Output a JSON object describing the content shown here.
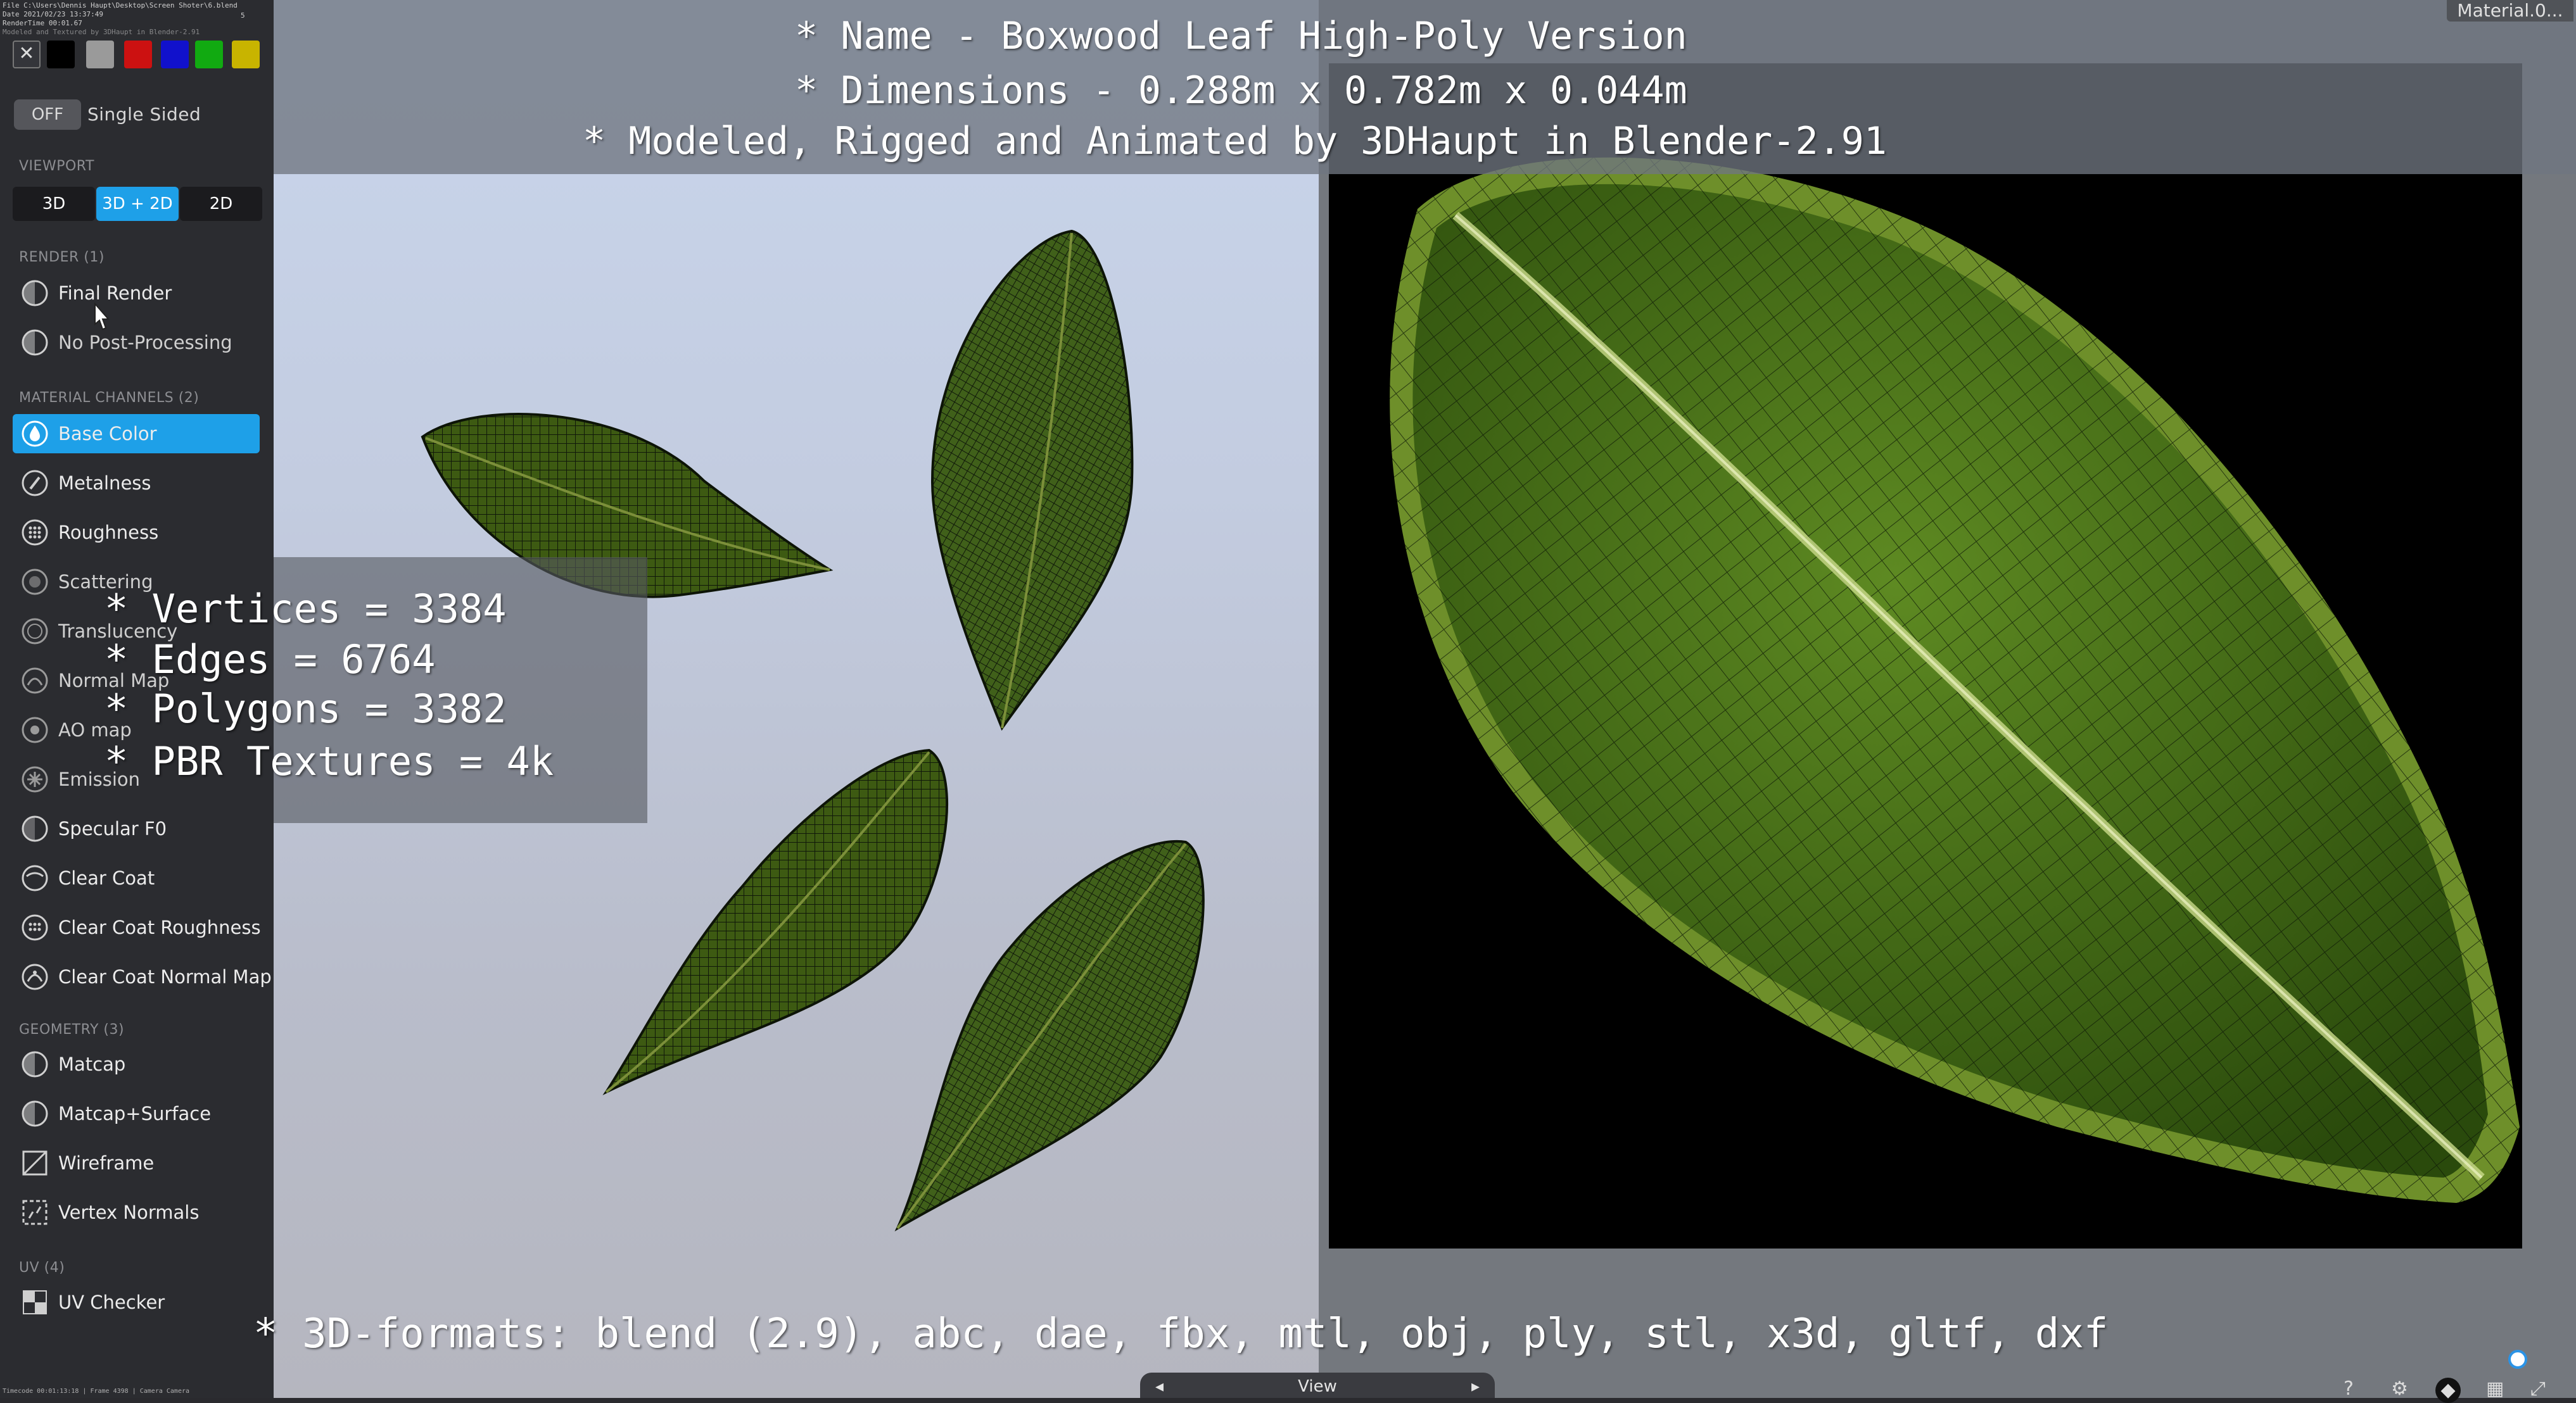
{
  "app": {
    "meta_lines": [
      "File C:\\Users\\Dennis Haupt\\Desktop\\Screen Shoter\\6.blend",
      "Date 2021/02/23 13:37:49",
      "RenderTime 00:01.67",
      "Modeled and Textured by 3DHaupt in Blender-2.91"
    ],
    "meta_corner": "5",
    "bottom_meta": "Timecode 00:01:13:18 | Frame 4398 | Camera Camera"
  },
  "sidebar": {
    "swatch_colors": [
      "#2b2c30",
      "#000000",
      "#9a9a9a",
      "#cc1111",
      "#1111cc",
      "#11aa11",
      "#c8b400"
    ],
    "single_sided_toggle": "OFF",
    "single_sided_label": "Single Sided",
    "viewport_header": "VIEWPORT",
    "viewport_buttons": [
      "3D",
      "3D + 2D",
      "2D"
    ],
    "render_header": "RENDER (1)",
    "render_items": [
      "Final Render",
      "No Post-Processing"
    ],
    "material_header": "MATERIAL CHANNELS (2)",
    "material_items": [
      "Base Color",
      "Metalness",
      "Roughness",
      "Scattering",
      "Translucency",
      "Normal Map",
      "AO map",
      "Emission",
      "Specular F0",
      "Clear Coat",
      "Clear Coat Roughness",
      "Clear Coat Normal Map"
    ],
    "geometry_header": "GEOMETRY (3)",
    "geometry_items": [
      "Matcap",
      "Matcap+Surface",
      "Wireframe",
      "Vertex Normals"
    ],
    "uv_header": "UV (4)",
    "uv_items": [
      "UV Checker"
    ]
  },
  "overlay": {
    "name_line": "* Name - Boxwood Leaf High-Poly Version",
    "dimensions_line": "* Dimensions -  0.288m x 0.782m x 0.044m",
    "credit_line": "* Modeled, Rigged and Animated by 3DHaupt in Blender-2.91",
    "stats": [
      "* Vertices = 3384",
      "* Edges = 6764",
      "* Polygons = 3382",
      "* PBR Textures = 4k"
    ],
    "formats_line": "* 3D-formats: blend (2.9), abc, dae, fbx, mtl, obj, ply, stl, x3d, gltf, dxf"
  },
  "viewer": {
    "material_label": "Material.0...",
    "view_tab_label": "View",
    "bottom_icons": [
      "?",
      "gear-icon",
      "layers-icon",
      "grid-icon",
      "fullscreen-icon"
    ]
  },
  "colors": {
    "accent": "#1ea0e8",
    "leaf_dark": "#3a5216",
    "leaf_light": "#6f9a2a"
  }
}
